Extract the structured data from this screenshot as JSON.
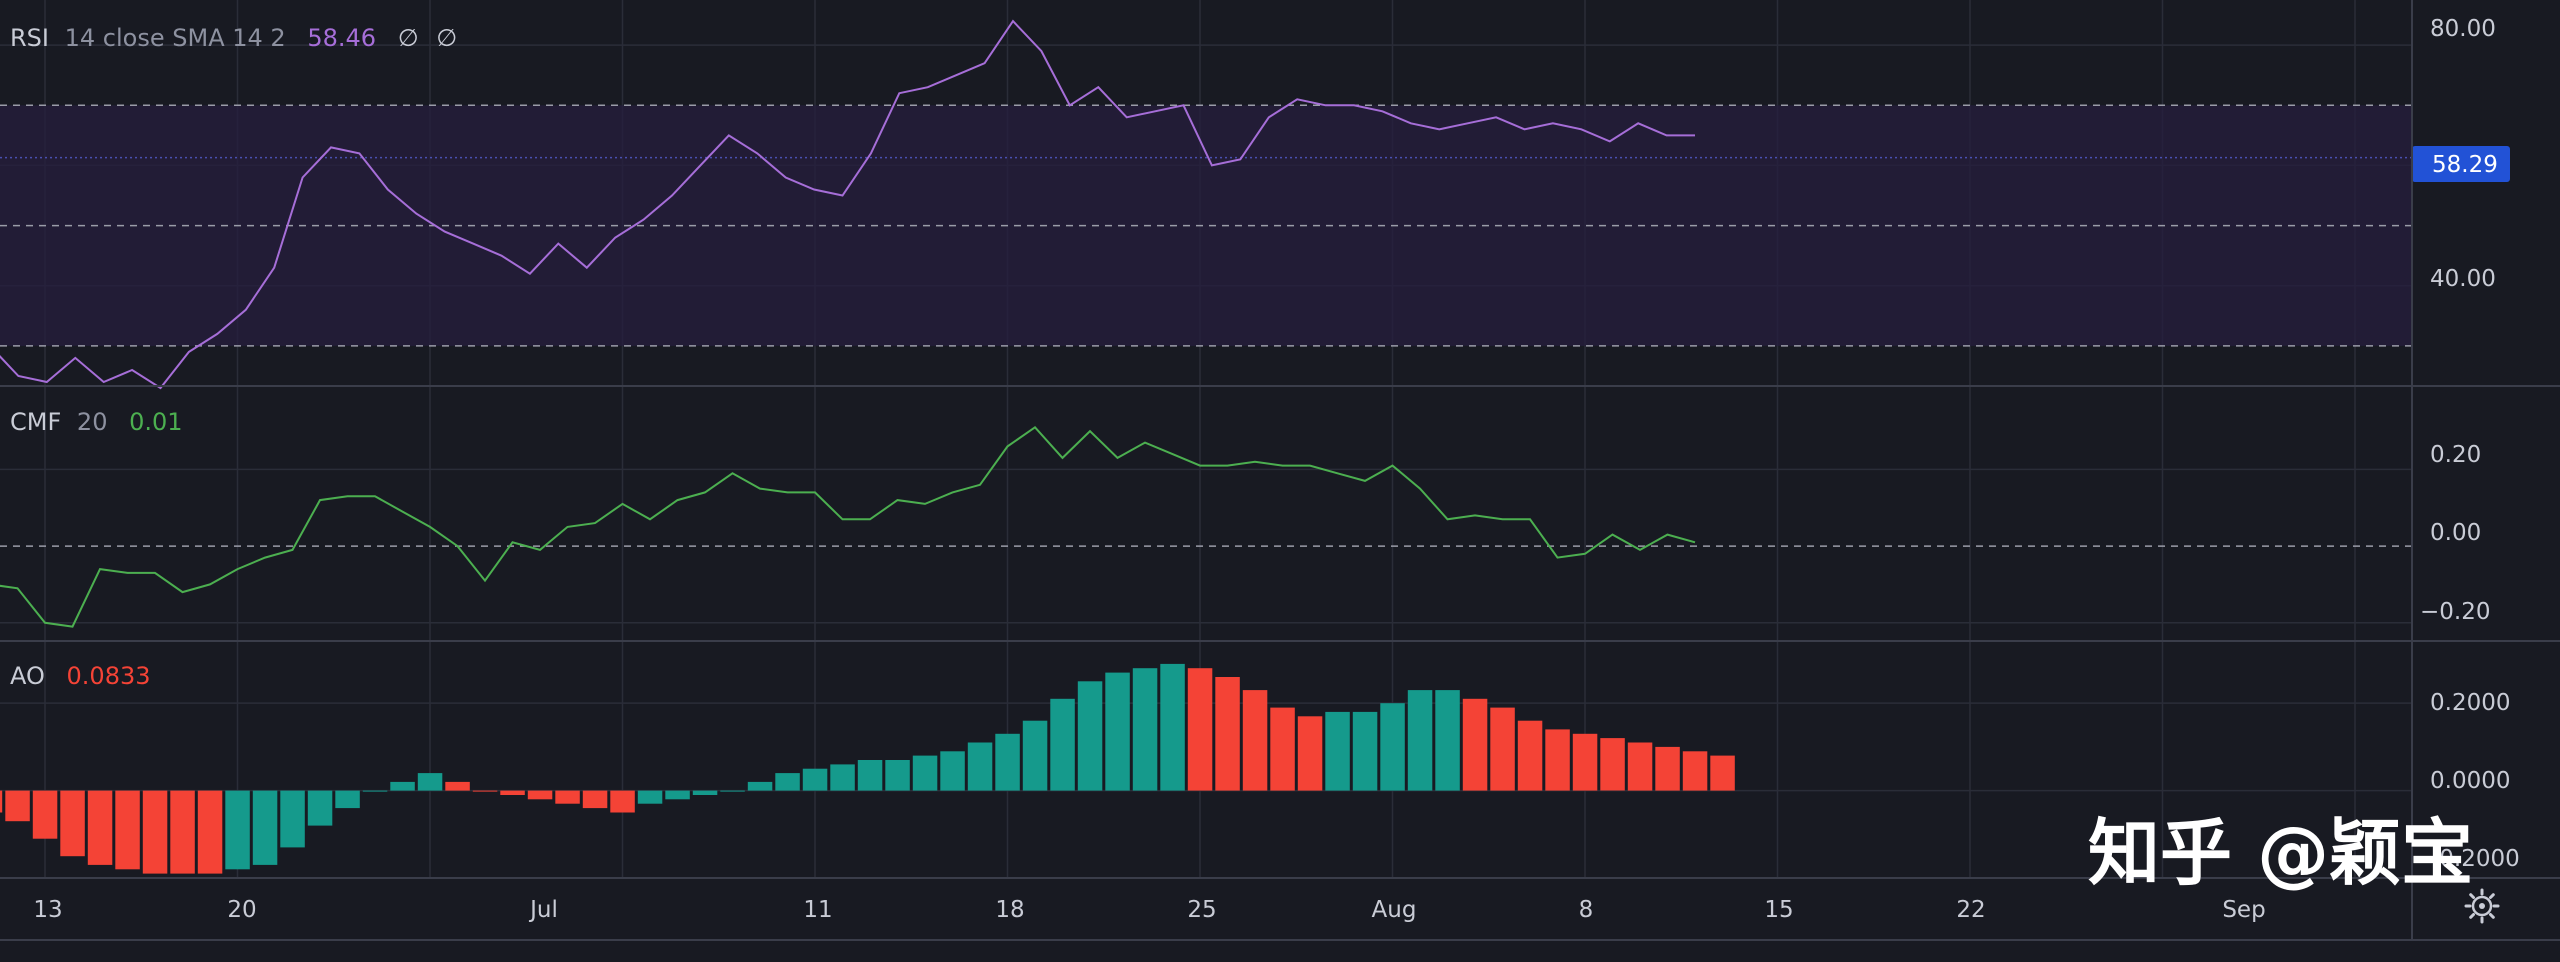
{
  "colors": {
    "background": "#181a22",
    "grid": "#2a2d38",
    "rsi_line": "#a66ed8",
    "rsi_band": "#261d3d",
    "rsi_ma_line": "#4a4fb0",
    "cmf_line": "#4caf50",
    "ao_green": "#159a8c",
    "ao_red": "#f44336",
    "price_tag": "#2252d6",
    "text": "#c9ccd6",
    "ao_value": "#f44336"
  },
  "panes": {
    "rsi": {
      "name": "RSI",
      "params": "14 close SMA 14 2",
      "value": "58.46",
      "extra1": "∅",
      "extra2": "∅",
      "tag_value": "58.29",
      "axis_labels": [
        "80.00",
        "40.00"
      ]
    },
    "cmf": {
      "name": "CMF",
      "params": "20",
      "value": "0.01",
      "axis_labels": [
        "0.20",
        "0.00",
        "−0.20"
      ]
    },
    "ao": {
      "name": "AO",
      "value": "0.0833",
      "axis_labels": [
        "0.2000",
        "0.0000",
        "−0.2000"
      ]
    }
  },
  "time_axis": {
    "labels": [
      "13",
      "20",
      "Jul",
      "11",
      "18",
      "25",
      "Aug",
      "8",
      "15",
      "22",
      "Sep"
    ],
    "settings_icon": "gear-icon"
  },
  "watermark": "知乎 @颖宝",
  "chart_data": [
    {
      "type": "line",
      "title": "RSI 14 close SMA 14 2",
      "x_start_date": "2022-06-11",
      "x_end_date": "2022-08-12",
      "values": [
        30,
        25,
        24,
        28,
        24,
        26,
        23,
        29,
        32,
        36,
        43,
        58,
        63,
        62,
        56,
        52,
        49,
        47,
        45,
        42,
        47,
        43,
        48,
        51,
        55,
        60,
        65,
        62,
        58,
        56,
        55,
        62,
        72,
        73,
        75,
        77,
        84,
        79,
        70,
        73,
        68,
        69,
        70,
        60,
        61,
        68,
        71,
        70,
        70,
        69,
        67,
        66,
        67,
        68,
        66,
        67,
        66,
        64,
        67,
        65,
        65
      ],
      "reference_lines": [
        70,
        50,
        30
      ],
      "ylim": [
        23.5,
        87.5
      ]
    },
    {
      "type": "line",
      "title": "CMF 20",
      "x_start_date": "2022-06-11",
      "x_end_date": "2022-08-12",
      "values": [
        -0.1,
        -0.11,
        -0.2,
        -0.21,
        -0.06,
        -0.07,
        -0.07,
        -0.12,
        -0.1,
        -0.06,
        -0.03,
        -0.01,
        0.12,
        0.13,
        0.13,
        0.09,
        0.05,
        0.0,
        -0.09,
        0.01,
        -0.01,
        0.05,
        0.06,
        0.11,
        0.07,
        0.12,
        0.14,
        0.19,
        0.15,
        0.14,
        0.14,
        0.07,
        0.07,
        0.12,
        0.11,
        0.14,
        0.16,
        0.26,
        0.31,
        0.23,
        0.3,
        0.23,
        0.27,
        0.24,
        0.21,
        0.21,
        0.22,
        0.21,
        0.21,
        0.19,
        0.17,
        0.21,
        0.15,
        0.07,
        0.08,
        0.07,
        0.07,
        -0.03,
        -0.02,
        0.03,
        -0.01,
        0.03,
        0.01
      ],
      "reference_lines": [
        0
      ],
      "ylim": [
        -0.245,
        0.415
      ]
    },
    {
      "type": "bar",
      "title": "AO",
      "x_start_date": "2022-06-11",
      "x_end_date": "2022-08-13",
      "values": [
        -0.05,
        -0.07,
        -0.11,
        -0.15,
        -0.17,
        -0.18,
        -0.19,
        -0.19,
        -0.19,
        -0.18,
        -0.17,
        -0.13,
        -0.08,
        -0.04,
        0.0,
        0.02,
        0.04,
        0.02,
        0.0,
        -0.01,
        -0.02,
        -0.03,
        -0.04,
        -0.05,
        -0.03,
        -0.02,
        -0.01,
        0.0,
        0.02,
        0.04,
        0.05,
        0.06,
        0.07,
        0.07,
        0.08,
        0.09,
        0.11,
        0.13,
        0.16,
        0.21,
        0.25,
        0.27,
        0.28,
        0.29,
        0.28,
        0.26,
        0.23,
        0.19,
        0.17,
        0.18,
        0.18,
        0.2,
        0.23,
        0.23,
        0.21,
        0.19,
        0.16,
        0.14,
        0.13,
        0.12,
        0.11,
        0.1,
        0.09,
        0.08
      ],
      "colors": [
        "red",
        "red",
        "red",
        "red",
        "red",
        "red",
        "red",
        "red",
        "red",
        "green",
        "green",
        "green",
        "green",
        "green",
        "green",
        "green",
        "green",
        "red",
        "red",
        "red",
        "red",
        "red",
        "red",
        "red",
        "green",
        "green",
        "green",
        "green",
        "green",
        "green",
        "green",
        "green",
        "green",
        "green",
        "green",
        "green",
        "green",
        "green",
        "green",
        "green",
        "green",
        "green",
        "green",
        "green",
        "red",
        "red",
        "red",
        "red",
        "red",
        "green",
        "green",
        "green",
        "green",
        "green",
        "red",
        "red",
        "red",
        "red",
        "red",
        "red",
        "red",
        "red",
        "red",
        "red"
      ],
      "reference_lines": [
        0
      ],
      "ylim": [
        -0.2,
        0.34
      ]
    }
  ]
}
